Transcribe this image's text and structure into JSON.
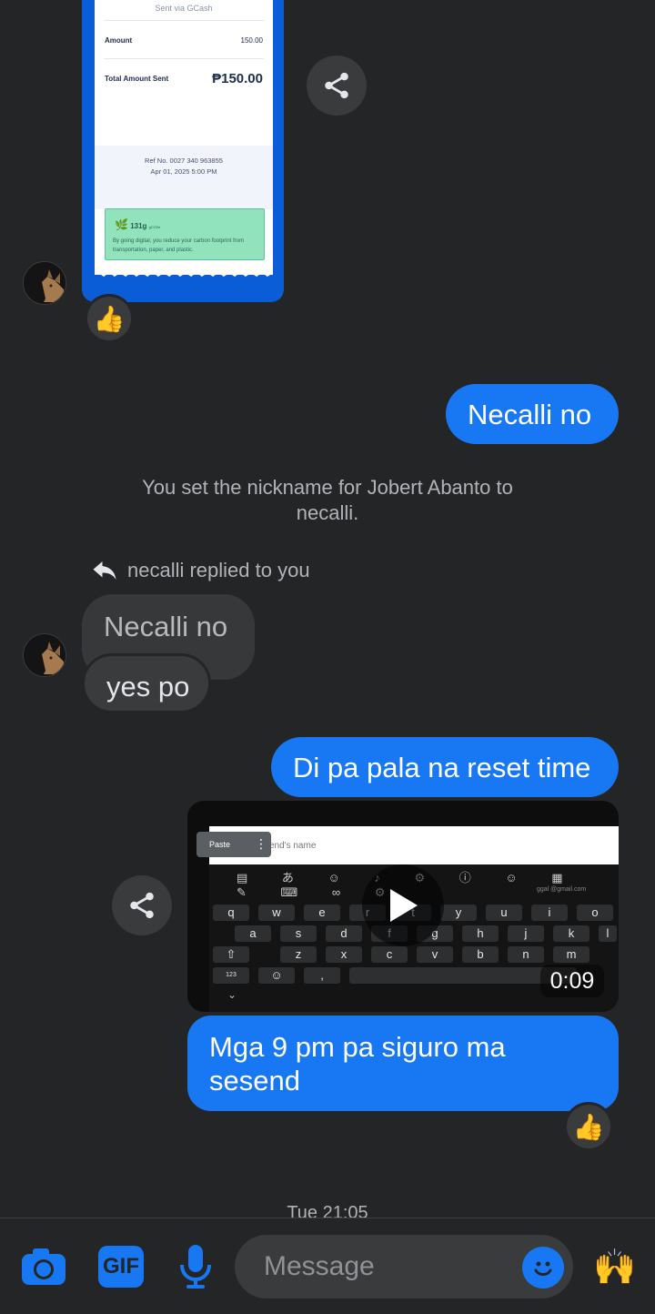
{
  "receipt": {
    "sent_via": "Sent via GCash",
    "amount_label": "Amount",
    "amount_value": "150.00",
    "total_label": "Total Amount Sent",
    "total_value": "₱150.00",
    "ref_line": "Ref No. 0027 340 963855",
    "date_line": "Apr 01, 2025 5:00 PM",
    "carbon_title": "131g",
    "carbon_unit": "gCO2e",
    "carbon_desc": "By going digital, you reduce your carbon footprint from transportation, paper, and plastic."
  },
  "reactions": {
    "receipt": "👍",
    "last_message": "👍"
  },
  "messages": {
    "out_1": "Necalli no",
    "system": "You set the nickname for Jobert Abanto to necalli.",
    "reply_label": "necalli replied to you",
    "quoted": "Necalli no",
    "in_1": "yes po",
    "out_2": "Di pa pala na reset time",
    "out_3": "Mga 9 pm pa siguro ma sesend"
  },
  "video": {
    "duration": "0:09",
    "paste_label": "Paste",
    "field_hint": "end's name",
    "suggestion": "ggal @gmail.com",
    "row1": [
      "q",
      "w",
      "e",
      "r",
      "t",
      "y",
      "u",
      "i",
      "o"
    ],
    "row2": [
      "a",
      "s",
      "d",
      "f",
      "g",
      "h",
      "j",
      "k",
      "l"
    ],
    "row3": [
      "z",
      "x",
      "c",
      "v",
      "b",
      "n",
      "m"
    ],
    "num_key": "123"
  },
  "timestamp": "Tue 21:05",
  "composer": {
    "placeholder": "Message",
    "gif_label": "GIF",
    "quick_reaction": "🙌"
  },
  "colors": {
    "accent": "#1877f2",
    "background": "#242526",
    "bubble_in": "#3a3b3c",
    "gcash_blue": "#0b5cd7"
  }
}
